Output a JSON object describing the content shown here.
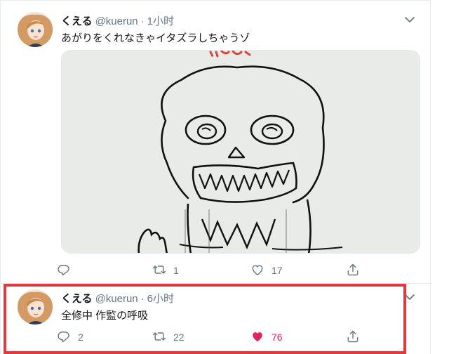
{
  "tweets": [
    {
      "name": "くえる",
      "handle": "@kuerun",
      "separator": "·",
      "time": "1小时",
      "text": "あがりをくれなきゃイタズラしちゃうゾ",
      "replies": "",
      "retweets": "1",
      "likes": "17",
      "liked": false
    },
    {
      "name": "くえる",
      "handle": "@kuerun",
      "separator": "·",
      "time": "6小时",
      "text": "全修中 作監の呼吸",
      "replies": "2",
      "retweets": "22",
      "likes": "76",
      "liked": true
    }
  ],
  "icons": [
    "avatar-illustration",
    "chevron-down-icon",
    "reply-icon",
    "retweet-icon",
    "heart-icon",
    "share-icon"
  ],
  "colors": {
    "like_active": "#e0245e",
    "muted": "#657786",
    "highlight_border": "#e13a3e",
    "divider": "#e6ecf0"
  }
}
